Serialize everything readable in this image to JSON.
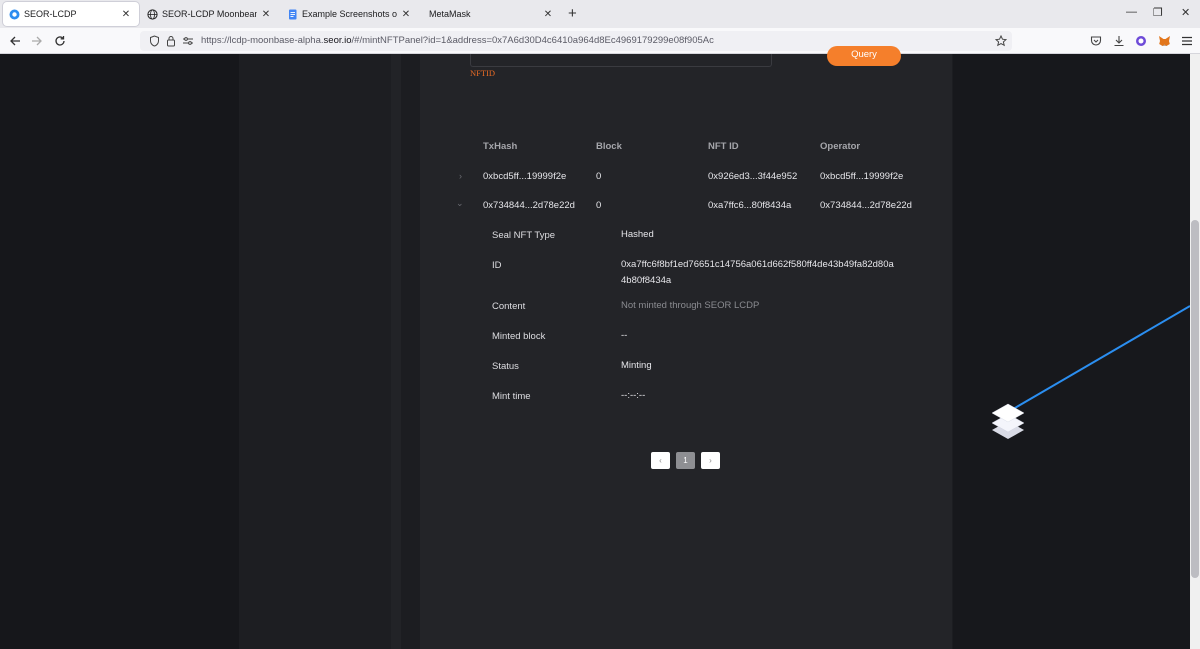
{
  "browser": {
    "tabs": [
      {
        "label": "SEOR-LCDP",
        "icon": "seor-logo-icon",
        "active": true
      },
      {
        "label": "SEOR-LCDP Moonbeam Testnet",
        "icon": "globe-icon",
        "active": false
      },
      {
        "label": "Example Screenshots of Moonbeam",
        "icon": "google-docs-icon",
        "active": false
      },
      {
        "label": "MetaMask",
        "icon": "",
        "active": false
      }
    ],
    "close_glyph": "✕",
    "new_tab_glyph": "+",
    "window_controls": {
      "minimize": "—",
      "restore": "❐",
      "close": "✕"
    },
    "url_prefix": "https://lcdp-moonbase-alpha.",
    "url_domain": "seor.io",
    "url_suffix": "/#/mintNFTPanel?id=1&address=0x7A6d30D4c6410a964d8Ec4969179299e08f905Ac"
  },
  "page": {
    "nftid_label": "NFTID",
    "query_button": "Query",
    "table": {
      "headers": [
        "TxHash",
        "Block",
        "NFT ID",
        "Operator"
      ],
      "rows": [
        {
          "expander": "›",
          "txhash": "0xbcd5ff...19999f2e",
          "block": "0",
          "nft_id": "0x926ed3...3f44e952",
          "operator": "0xbcd5ff...19999f2e"
        },
        {
          "expander": "⌄",
          "txhash": "0x734844...2d78e22d",
          "block": "0",
          "nft_id": "0xa7ffc6...80f8434a",
          "operator": "0x734844...2d78e22d"
        }
      ]
    },
    "detail": {
      "seal_type_label": "Seal NFT Type",
      "seal_type_value": "Hashed",
      "id_label": "ID",
      "id_value_line1": "0xa7ffc6f8bf1ed76651c14756a061d662f580ff4de43b49fa82d80a",
      "id_value_line2": "4b80f8434a",
      "content_label": "Content",
      "content_value": "Not minted through SEOR LCDP",
      "minted_block_label": "Minted block",
      "minted_block_value": "--",
      "status_label": "Status",
      "status_value": "Minting",
      "mint_time_label": "Mint time",
      "mint_time_value": "--:--:--"
    },
    "pagination": {
      "prev": "‹",
      "current": "1",
      "next": "›"
    }
  },
  "colors": {
    "accent": "#f57f2b",
    "label_orange": "#e86b25",
    "link_line": "#2b8ef0"
  }
}
